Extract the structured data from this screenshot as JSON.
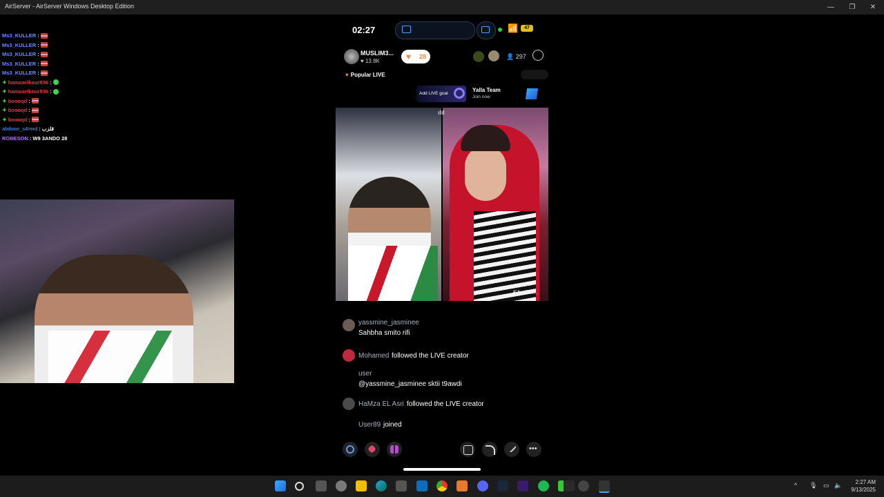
{
  "window": {
    "title": "AirServer - AirServer Windows Desktop Edition",
    "minimize": "—",
    "maximize": "❐",
    "close": "✕"
  },
  "chat": [
    {
      "user": "Ms3_KULLER",
      "sep": ":",
      "kind": "flag",
      "color": "blue"
    },
    {
      "user": "Ms3_KULLER",
      "sep": ":",
      "kind": "flag",
      "color": "blue"
    },
    {
      "user": "Ms3_KULLER",
      "sep": ":",
      "kind": "flag",
      "color": "blue"
    },
    {
      "user": "Ms3_KULLER",
      "sep": ":",
      "kind": "flag",
      "color": "blue"
    },
    {
      "user": "Ms3_KULLER",
      "sep": ":",
      "kind": "flag",
      "color": "blue"
    },
    {
      "user": "hamzaelkour936",
      "sep": ":",
      "kind": "green",
      "color": "red",
      "star": true
    },
    {
      "user": "hamzaelkour936",
      "sep": ":",
      "kind": "green",
      "color": "red",
      "star": true
    },
    {
      "user": "boooqd",
      "sep": ":",
      "kind": "flag",
      "color": "red",
      "star": true
    },
    {
      "user": "boooqd",
      "sep": ":",
      "kind": "flag",
      "color": "red",
      "star": true
    },
    {
      "user": "boooqd",
      "sep": ":",
      "kind": "flag",
      "color": "red",
      "star": true
    },
    {
      "user": "abdooo_s4mxd",
      "sep": ":",
      "text": "قلزب",
      "color": "user2"
    },
    {
      "user": "ROBESON",
      "sep": ":",
      "text": "W9 3ANDO 28",
      "color": "purple"
    }
  ],
  "phone": {
    "clock": "02:27",
    "battery": "47",
    "host": {
      "name": "MUSLIM3...",
      "likes": "♥ 13.8K",
      "follow_count": "28"
    },
    "viewers": "297",
    "popular": "Popular LIVE",
    "goal_label": "Add LIVE goal",
    "yalla_title": "Yalla Team",
    "yalla_sub": "Join now",
    "watermark": "Khokh...",
    "feed": [
      {
        "user": "yassmine_jasminee",
        "msg": "Sahbha smito rifi"
      },
      {
        "user": "Mohamed",
        "msg": "followed the LIVE creator"
      },
      {
        "user": "user",
        "msg": "@yassmine_jasminee sktii t9awdi"
      },
      {
        "user": "HaMza EL Asri",
        "msg": "followed the LIVE creator"
      },
      {
        "user": "User89",
        "msg": "joined"
      }
    ]
  },
  "taskbar": {
    "time": "2:27 AM",
    "date": "9/13/2025",
    "chevron": "^"
  },
  "colors": {
    "accent": "#f28a2e",
    "chat_blue": "#6a8cff",
    "chat_red": "#e03a3a"
  }
}
